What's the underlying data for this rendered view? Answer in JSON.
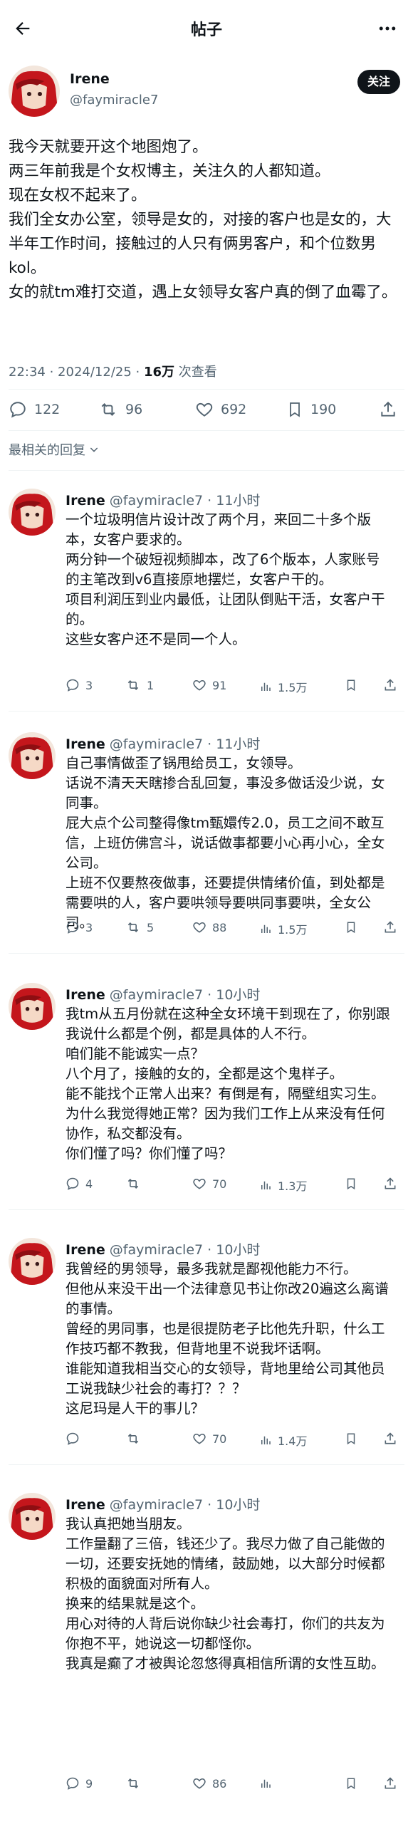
{
  "header": {
    "title": "帖子",
    "back_icon": "arrow-left-icon",
    "more_icon": "more-dots-icon"
  },
  "post": {
    "author_name": "Irene",
    "author_handle": "@faymiracle7",
    "follow_label": "关注",
    "text": "我今天就要开这个地图炮了。\n两三年前我是个女权博主，关注久的人都知道。\n现在女权不起来了。\n我们全女办公室，领导是女的，对接的客户也是女的，大半年工作时间，接触过的人只有俩男客户，和个位数男kol。\n女的就tm难打交道，遇上女领导女客户真的倒了血霉了。",
    "time": "22:34 · 2024/12/25 · ",
    "views": "16万",
    "views_suffix": " 次查看",
    "stats": {
      "replies": "122",
      "retweets": "96",
      "likes": "692",
      "bookmarks": "190"
    }
  },
  "sort_label": "最相关的回复",
  "replies": [
    {
      "name": "Irene",
      "meta": " @faymiracle7 · 11小时",
      "text": "一个垃圾明信片设计改了两个月，来回二十多个版本，女客户要求的。\n两分钟一个破短视频脚本，改了6个版本，人家账号的主笔改到v6直接原地摆烂，女客户干的。\n项目利润压到业内最低，让团队倒贴干活，女客户干的。\n这些女客户还不是同一个人。",
      "replies": "3",
      "retweets": "1",
      "likes": "91",
      "views": "1.5万"
    },
    {
      "name": "Irene",
      "meta": " @faymiracle7 · 11小时",
      "text": "自己事情做歪了锅甩给员工，女领导。\n话说不清天天瞎掺合乱回复，事没多做话没少说，女同事。\n屁大点个公司整得像tm甄嬛传2.0，员工之间不敢互信，上班仿佛宫斗，说话做事都要小心再小心，全女公司。\n上班不仅要熬夜做事，还要提供情绪价值，到处都是需要哄的人，客户要哄领导要哄同事要哄，全女公司。",
      "replies": "3",
      "retweets": "5",
      "likes": "88",
      "views": "1.5万"
    },
    {
      "name": "Irene",
      "meta": " @faymiracle7 · 10小时",
      "text": "我tm从五月份就在这种全女环境干到现在了，你别跟我说什么都是个例，都是具体的人不行。\n咱们能不能诚实一点？\n八个月了，接触的女的，全都是这个鬼样子。\n能不能找个正常人出来？有倒是有，隔壁组实习生。\n为什么我觉得她正常？因为我们工作上从来没有任何协作，私交都没有。\n你们懂了吗？你们懂了吗？",
      "replies": "4",
      "retweets": "",
      "likes": "70",
      "views": "1.3万"
    },
    {
      "name": "Irene",
      "meta": " @faymiracle7 · 10小时",
      "text": "我曾经的男领导，最多我就是鄙视他能力不行。\n但他从来没干出一个法律意见书让你改20遍这么离谱的事情。\n曾经的男同事，也是很提防老子比他先升职，什么工作技巧都不教我，但背地里不说我坏话啊。\n谁能知道我相当交心的女领导，背地里给公司其他员工说我缺少社会的毒打？？？\n这尼玛是人干的事儿？",
      "replies": "",
      "retweets": "",
      "likes": "70",
      "views": "1.4万"
    },
    {
      "name": "Irene",
      "meta": " @faymiracle7 · 10小时",
      "text": "我认真把她当朋友。\n工作量翻了三倍，钱还少了。我尽力做了自己能做的一切，还要安抚她的情绪，鼓励她，以大部分时候都积极的面貌面对所有人。\n换来的结果就是这个。\n用心对待的人背后说你缺少社会毒打，你们的共友为你抱不平，她说这一切都怪你。\n我真是癫了才被舆论忽悠得真相信所谓的女性互助。",
      "replies": "9",
      "retweets": "",
      "likes": "86",
      "views": ""
    }
  ],
  "colors": {
    "text": "#0f1419",
    "secondary": "#536471",
    "avatar_red": "#c4161c",
    "divider": "#eff3f4"
  }
}
